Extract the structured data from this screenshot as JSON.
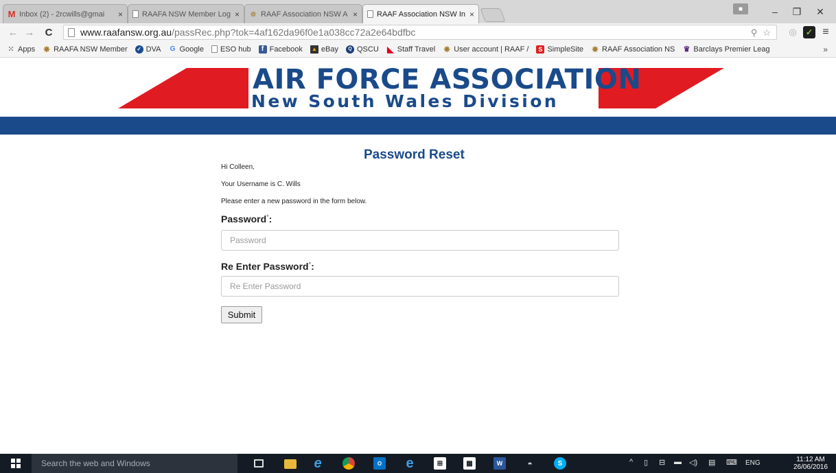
{
  "browser": {
    "tabs": [
      {
        "label": "Inbox (2) - 2rcwills@gmai",
        "icon": "gmail-icon"
      },
      {
        "label": "RAAFA NSW Member Log",
        "icon": "page-icon"
      },
      {
        "label": "RAAF Association NSW A",
        "icon": "emblem-icon"
      },
      {
        "label": "RAAF Association NSW In",
        "icon": "page-icon"
      }
    ],
    "tab_close": "×",
    "window_controls": {
      "minimize": "–",
      "restore": "❐",
      "close": "✕"
    },
    "nav": {
      "back": "←",
      "forward": "→",
      "reload": "C"
    },
    "url": {
      "host": "www.raafansw.org.au",
      "path": "/passRec.php?tok=4af162da96f0e1a038cc72a2e64bdfbc"
    },
    "omni_icons": {
      "key": "⚲",
      "star": "☆"
    },
    "extensions": {
      "ext1": "◎",
      "ext2": "✓",
      "menu": "≡"
    },
    "bookmarks": [
      {
        "label": "Apps",
        "icon": "apps"
      },
      {
        "label": "RAAFA NSW Member",
        "icon": "emblem"
      },
      {
        "label": "DVA",
        "icon": "dva"
      },
      {
        "label": "Google",
        "icon": "google"
      },
      {
        "label": "ESO hub",
        "icon": "page"
      },
      {
        "label": "Facebook",
        "icon": "fb"
      },
      {
        "label": "eBay",
        "icon": "ebay"
      },
      {
        "label": "QSCU",
        "icon": "qscu"
      },
      {
        "label": "Staff Travel",
        "icon": "qantas"
      },
      {
        "label": "User account | RAAF /",
        "icon": "emblem"
      },
      {
        "label": "SimpleSite",
        "icon": "simple"
      },
      {
        "label": "RAAF Association NS",
        "icon": "emblem"
      },
      {
        "label": "Barclays Premier Leag",
        "icon": "epl"
      }
    ],
    "bookmarks_more": "»"
  },
  "banner": {
    "title": "AIR FORCE ASSOCIATION",
    "subtitle": "New South Wales Division",
    "colors": {
      "red": "#e11b22",
      "blue": "#1a4a8a"
    }
  },
  "form": {
    "heading": "Password Reset",
    "greeting": "Hi Colleen,",
    "username_line": "Your Username is C. Wills",
    "instruction": "Please enter a new password in the form below.",
    "password_label": "Password",
    "password_placeholder": "Password",
    "reenter_label": "Re Enter Password",
    "reenter_placeholder": "Re Enter Password",
    "required_marker": "*",
    "label_suffix": ":",
    "submit_label": "Submit"
  },
  "taskbar": {
    "search_placeholder": "Search the web and Windows",
    "tray_language": "ENG",
    "time": "11:12 AM",
    "date": "26/06/2016",
    "apps": [
      "task-view",
      "file-explorer",
      "internet-explorer",
      "chrome",
      "outlook",
      "edge",
      "store",
      "calculator",
      "word",
      "network-app",
      "skype"
    ]
  }
}
